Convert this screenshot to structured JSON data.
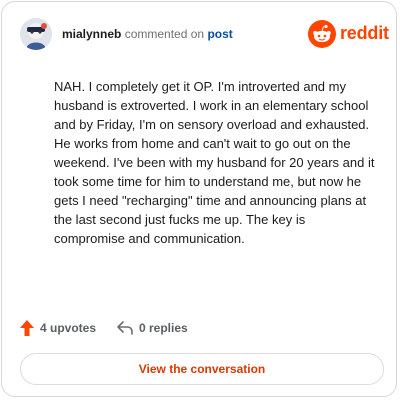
{
  "comment": {
    "username": "mialynneb",
    "action_text": "commented on",
    "post_link": "post",
    "body": "NAH. I completely get it OP. I'm introverted and my husband is extroverted. I work in an elementary school and by Friday, I'm on sensory overload and exhausted. He works from home and can't wait to go out on the weekend. I've been with my husband for 20 years and it took some time for him to understand me, but now he gets I need \"recharging\" time and announcing plans at the last second just fucks me up. The key is compromise and communication."
  },
  "brand": {
    "name": "reddit",
    "icon": "reddit-logo-icon",
    "color": "#ff4500"
  },
  "stats": {
    "upvotes": "4 upvotes",
    "upvote_icon": "upvote-arrow-icon",
    "replies": "0 replies",
    "reply_icon": "reply-arrow-icon"
  },
  "actions": {
    "view_conversation": "View the conversation"
  },
  "colors": {
    "accent": "#d93a00",
    "upvote": "#ff4500",
    "link": "#0a4f9c"
  }
}
